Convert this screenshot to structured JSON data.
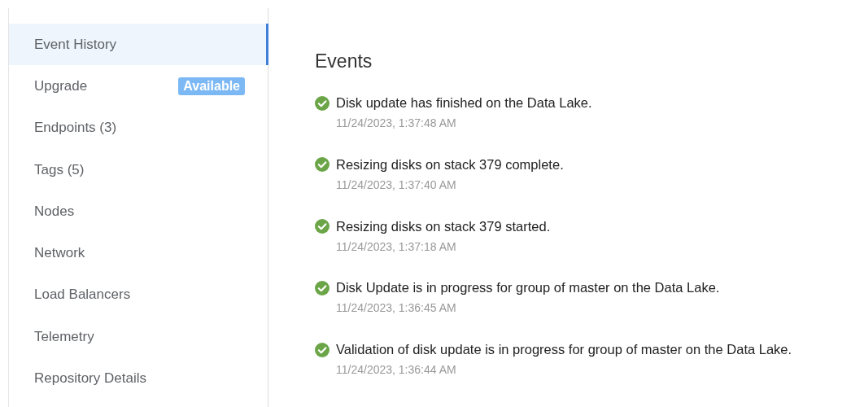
{
  "sidebar": {
    "items": [
      {
        "label": "Event History",
        "selected": true
      },
      {
        "label": "Upgrade",
        "selected": false,
        "badge": "Available"
      },
      {
        "label": "Endpoints (3)",
        "selected": false
      },
      {
        "label": "Tags (5)",
        "selected": false
      },
      {
        "label": "Nodes",
        "selected": false
      },
      {
        "label": "Network",
        "selected": false
      },
      {
        "label": "Load Balancers",
        "selected": false
      },
      {
        "label": "Telemetry",
        "selected": false
      },
      {
        "label": "Repository Details",
        "selected": false
      }
    ]
  },
  "main": {
    "title": "Events",
    "events": [
      {
        "kind": "success",
        "message": "Disk update has finished on the Data Lake.",
        "time": "11/24/2023, 1:37:48 AM"
      },
      {
        "kind": "success",
        "message": "Resizing disks on stack 379 complete.",
        "time": "11/24/2023, 1:37:40 AM"
      },
      {
        "kind": "success",
        "message": "Resizing disks on stack 379 started.",
        "time": "11/24/2023, 1:37:18 AM"
      },
      {
        "kind": "success",
        "message": "Disk Update is in progress for group of master on the Data Lake.",
        "time": "11/24/2023, 1:36:45 AM"
      },
      {
        "kind": "success",
        "message": "Validation of disk update is in progress for group of master on the Data Lake.",
        "time": "11/24/2023, 1:36:44 AM"
      }
    ]
  }
}
